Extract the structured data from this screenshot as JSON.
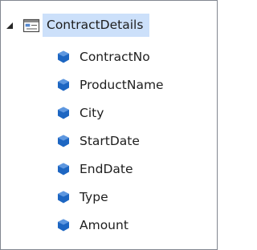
{
  "tree": {
    "root": {
      "label": "ContractDetails",
      "expanded": true,
      "icon": "table-icon"
    },
    "children": [
      {
        "label": "ContractNo",
        "icon": "field-icon"
      },
      {
        "label": "ProductName",
        "icon": "field-icon"
      },
      {
        "label": "City",
        "icon": "field-icon"
      },
      {
        "label": "StartDate",
        "icon": "field-icon"
      },
      {
        "label": "EndDate",
        "icon": "field-icon"
      },
      {
        "label": "Type",
        "icon": "field-icon"
      },
      {
        "label": "Amount",
        "icon": "field-icon"
      }
    ]
  },
  "colors": {
    "selection_background": "#cce0fa",
    "field_icon": "#1d66c2",
    "border": "#828790"
  }
}
